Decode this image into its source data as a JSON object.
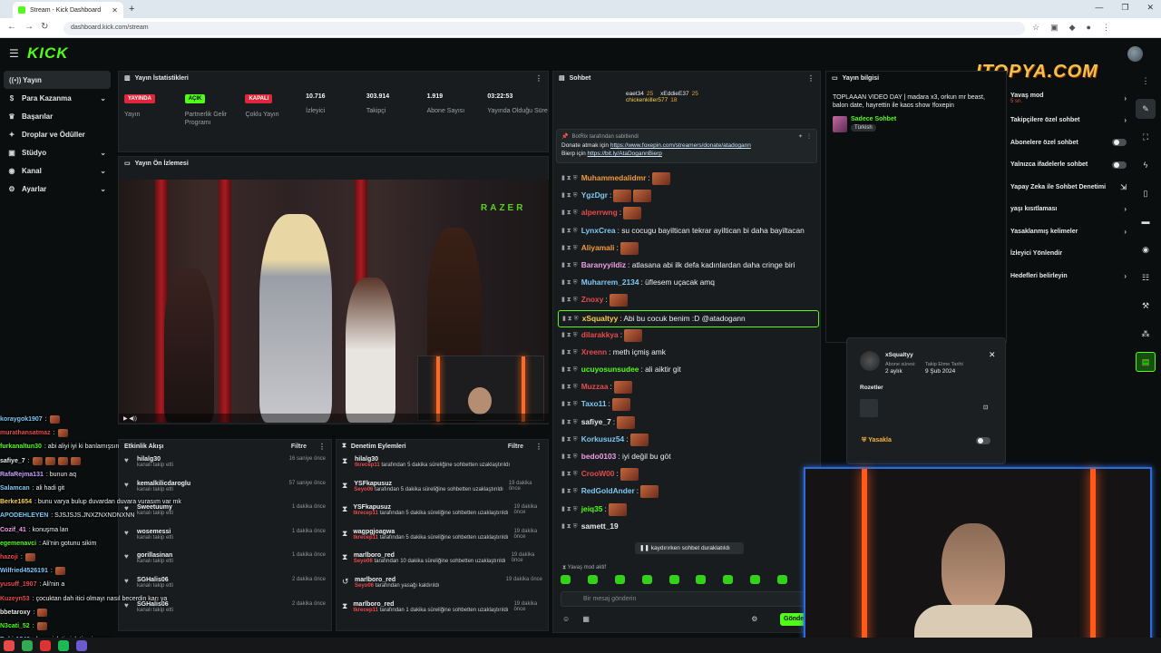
{
  "browser": {
    "tab_title": "Stream - Kick Dashboard",
    "url": "dashboard.kick.com/stream"
  },
  "logo": "KICK",
  "overlay_logo": "ITOPYA.COM",
  "nav": [
    {
      "icon": "broadcast-icon",
      "label": "Yayın",
      "active": true
    },
    {
      "icon": "money-icon",
      "label": "Para Kazanma",
      "chevron": true
    },
    {
      "icon": "trophy-icon",
      "label": "Başarılar"
    },
    {
      "icon": "gift-icon",
      "label": "Droplar ve Ödüller"
    },
    {
      "icon": "studio-icon",
      "label": "Stüdyo",
      "chevron": true
    },
    {
      "icon": "channel-icon",
      "label": "Kanal",
      "chevron": true
    },
    {
      "icon": "gear-icon",
      "label": "Ayarlar",
      "chevron": true
    }
  ],
  "stats": {
    "title": "Yayın İstatistikleri",
    "items": [
      {
        "badge": "YAYINDA",
        "badge_color": "#e0263a",
        "label": "Yayın"
      },
      {
        "badge": "AÇIK",
        "badge_color": "#53fc18",
        "label": "Partnerlik Gelir Programı"
      },
      {
        "badge": "KAPALI",
        "badge_color": "#e0263a",
        "label": "Çoklu Yayın"
      },
      {
        "value": "10.716",
        "label": "İzleyici"
      },
      {
        "value": "303.914",
        "label": "Takipçi"
      },
      {
        "value": "1.919",
        "label": "Abone Sayısı"
      },
      {
        "value": "03:22:53",
        "label": "Yayında Olduğu Süre"
      }
    ]
  },
  "preview": {
    "title": "Yayın Ön İzlemesi",
    "brand": "RAZER"
  },
  "stream_chat": [
    {
      "u": "koraygok1907",
      "c": "#7ec8f2",
      "m": ":",
      "e": 1
    },
    {
      "u": "murathansatmaz",
      "c": "#e84a4a",
      "m": ":",
      "e": 1
    },
    {
      "u": "furkanaltun30",
      "c": "#53fc18",
      "m": ": abi aliyi iyi ki banlamışsın",
      "e": 0
    },
    {
      "u": "safiye_7",
      "c": "#e8e8e8",
      "m": ":",
      "e": 4
    },
    {
      "u": "RafaRejma131",
      "c": "#c6a0ff",
      "m": ": bunun aq",
      "e": 0
    },
    {
      "u": "Salamcan",
      "c": "#7ec8f2",
      "m": ": ali hadi git",
      "e": 0
    },
    {
      "u": "Berke1654",
      "c": "#f7d04a",
      "m": ": bunu varya bulup duvardan duvara vurasım var mk",
      "e": 0
    },
    {
      "u": "APODEHLEYEN",
      "c": "#7ec8f2",
      "m": ": SJSJSJS.JNXZNXNDNXNN",
      "e": 0
    },
    {
      "u": "Cozif_41",
      "c": "#f29ee8",
      "m": ": konuşma lan",
      "e": 0
    },
    {
      "u": "egemenavci",
      "c": "#53fc18",
      "m": ": Ali'nin gotunu sikim",
      "e": 0
    },
    {
      "u": "hazoji",
      "c": "#e84a4a",
      "m": ":",
      "e": 1
    },
    {
      "u": "Wilfried4526191",
      "c": "#7ec8f2",
      "m": ":",
      "e": 1
    },
    {
      "u": "yusuff_1907",
      "c": "#e84a4a",
      "m": ": Ali'nin a",
      "e": 0
    },
    {
      "u": "Kuzeyn53",
      "c": "#e84a4a",
      "m": ": çocuktan dah itici olmayı nasıl becerdin karı ya",
      "e": 0
    },
    {
      "u": "bbetaroxy",
      "c": "#e8e8e8",
      "m": ":",
      "e": 1
    },
    {
      "u": "N3cati_52",
      "c": "#53fc18",
      "m": ":",
      "e": 1
    },
    {
      "u": "Bekir1840",
      "c": "#7ec8f2",
      "m": ": bunu islatip islatip si neyse",
      "e": 0
    }
  ],
  "activity": {
    "title": "Etkinlik Akışı",
    "filter": "Filtre",
    "items": [
      {
        "name": "hilalg30",
        "action": "kanalı takip etti",
        "when": "16 saniye önce"
      },
      {
        "name": "kemalkilicdaroglu",
        "action": "kanalı takip etti",
        "when": "57 saniye önce"
      },
      {
        "name": "Sweetuumy",
        "action": "kanalı takip etti",
        "when": "1 dakika önce"
      },
      {
        "name": "wosemessi",
        "action": "kanalı takip etti",
        "when": "1 dakika önce"
      },
      {
        "name": "gorillasinan",
        "action": "kanalı takip etti",
        "when": "1 dakika önce"
      },
      {
        "name": "SGHalis06",
        "action": "kanalı takip etti",
        "when": "2 dakika önce"
      },
      {
        "name": "SGHalis06",
        "action": "kanalı takip etti",
        "when": "2 dakika önce"
      }
    ]
  },
  "moderation": {
    "title": "Denetim Eylemleri",
    "filter": "Filtre",
    "items": [
      {
        "icon": "hourglass-icon",
        "name": "hilalg30",
        "mod": "tkrecep11",
        "text": "tarafından 5 dakika süreliğine sohbetten uzaklaştırıldı",
        "when": ""
      },
      {
        "icon": "hourglass-icon",
        "name": "YSFkapusuz",
        "mod": "Seyo06",
        "text": "tarafından 5 dakika süreliğine sohbetten uzaklaştırıldı",
        "when": "19 dakika önce"
      },
      {
        "icon": "hourglass-icon",
        "name": "YSFkapusuz",
        "mod": "tkrecep11",
        "text": "tarafından 5 dakika süreliğine sohbetten uzaklaştırıldı",
        "when": "19 dakika önce"
      },
      {
        "icon": "hourglass-icon",
        "name": "wagpgjoagwa",
        "mod": "tkrecep11",
        "text": "tarafından 5 dakika süreliğine sohbetten uzaklaştırıldı",
        "when": "19 dakika önce"
      },
      {
        "icon": "hourglass-icon",
        "name": "marlboro_red",
        "mod": "Seyo06",
        "text": "tarafından 10 dakika süreliğine sohbetten uzaklaştırıldı",
        "when": "19 dakika önce"
      },
      {
        "icon": "undo-icon",
        "name": "marlboro_red",
        "mod": "Seyo06",
        "text": "tarafından yasağı kaldırıldı",
        "when": "19 dakika önce"
      },
      {
        "icon": "hourglass-icon",
        "name": "marlboro_red",
        "mod": "tkrecep11",
        "text": "tarafından 1 dakika süreliğine sohbetten uzaklaştırıldı",
        "when": "19 dakika önce"
      }
    ]
  },
  "chat": {
    "title": "Sohbet",
    "leaders": [
      {
        "name": "eaet34",
        "count": "25"
      },
      {
        "name": "xEddieE37",
        "count": "25"
      },
      {
        "name": "chickenkiller577",
        "count": "18"
      }
    ],
    "pinned_by": "BotRix tarafından sabitlendi",
    "pinned_l1_pre": "Donate atmak için",
    "pinned_l1_link": "https://www.foxepin.com/streamers/donate/atadogann",
    "pinned_l2_pre": "Bierp için",
    "pinned_l2_link": "https://bit.ly/AtaDogannBierp",
    "messages": [
      {
        "u": "Muhammedalidmr",
        "c": "#f29a3a",
        "m": ":",
        "e": 1
      },
      {
        "u": "YgzDgr",
        "c": "#7ec8f2",
        "m": ":",
        "e": 2
      },
      {
        "u": "alperrwng",
        "c": "#e84a4a",
        "m": ":",
        "e": 1
      },
      {
        "u": "LynxCrea",
        "c": "#7ec8f2",
        "m": ": su cocugu bayiltican tekrar ayiltican bi daha bayiltacan",
        "e": 0
      },
      {
        "u": "Aliyamali",
        "c": "#f29a3a",
        "m": ":",
        "e": 1
      },
      {
        "u": "Baranyyildiz",
        "c": "#f29ee8",
        "m": ": atlasana abi ilk defa kadınlardan daha cringe biri",
        "e": 0
      },
      {
        "u": "Muharrem_2134",
        "c": "#7ec8f2",
        "m": ": üflesem uçacak amq",
        "e": 0
      },
      {
        "u": "Znoxy",
        "c": "#e84a4a",
        "m": ":",
        "e": 1
      },
      {
        "u": "xSqualtyy",
        "c": "#f7d04a",
        "m": ": Abi bu cocuk benim :D @atadogann",
        "e": 0,
        "hl": true
      },
      {
        "u": "dilarakkya",
        "c": "#e84a4a",
        "m": ":",
        "e": 1
      },
      {
        "u": "Xreenn",
        "c": "#e84a4a",
        "m": ": meth içmiş amk",
        "e": 0
      },
      {
        "u": "ucuyosunsudee",
        "c": "#53fc18",
        "m": ": ali aiktir git",
        "e": 0
      },
      {
        "u": "Muzzaa",
        "c": "#e84a4a",
        "m": ":",
        "e": 1
      },
      {
        "u": "Taxo11",
        "c": "#7ec8f2",
        "m": ":",
        "e": 1
      },
      {
        "u": "safiye_7",
        "c": "#e8e8e8",
        "m": ":",
        "e": 1
      },
      {
        "u": "Korkusuz54",
        "c": "#7ec8f2",
        "m": ":",
        "e": 1
      },
      {
        "u": "bedo0103",
        "c": "#f29ee8",
        "m": ": iyi değil bu göt",
        "e": 0
      },
      {
        "u": "CrooW00",
        "c": "#e84a4a",
        "m": ":",
        "e": 1
      },
      {
        "u": "RedGoldAnder",
        "c": "#7ec8f2",
        "m": ":",
        "e": 1
      },
      {
        "u": "jeiq35",
        "c": "#53fc18",
        "m": ":",
        "e": 1
      },
      {
        "u": "samett_19",
        "c": "#e8e8e8",
        "m": "",
        "e": 0
      }
    ],
    "pause_banner": "kaydırırken sohbet duraklatıldı",
    "slow_mode": "Yavaş mod aktif",
    "input_placeholder": "Bir mesaj gönderin",
    "send_label": "Gönder"
  },
  "stream_info": {
    "title": "Yayın bilgisi",
    "stream_title": "TOPLAAAN VIDEO DAY | madara x3, orkun mr beast, balon date, hayrettin ile kaos show !foxepin",
    "category": "Sadece Sohbet",
    "tag": "Türkish"
  },
  "settings": [
    {
      "label": "Yavaş mod",
      "sub": "5 sn.",
      "kind": "chevron"
    },
    {
      "label": "Takipçilere özel sohbet",
      "kind": "chevron"
    },
    {
      "label": "Abonelere özel sohbet",
      "kind": "toggle"
    },
    {
      "label": "Yalnızca ifadelerle sohbet",
      "kind": "toggle"
    },
    {
      "label": "Yapay Zeka ile Sohbet Denetimi",
      "kind": "ext"
    },
    {
      "label": "yaşı kısıtlaması",
      "kind": "chevron"
    },
    {
      "label": "Yasaklanmış kelimeler",
      "kind": "chevron"
    },
    {
      "label": "İzleyici Yönlendir",
      "kind": "none"
    },
    {
      "label": "Hedefleri belirleyin",
      "kind": "chevron"
    }
  ],
  "user_card": {
    "name": "xSqualtyy",
    "sub_label": "Abone süresi:",
    "sub_value": "2 aylık",
    "follow_label": "Takip Etme Tarihi",
    "follow_value": "9 Şub 2024",
    "badges_label": "Rozetler",
    "ban_label": "Yasakla"
  }
}
